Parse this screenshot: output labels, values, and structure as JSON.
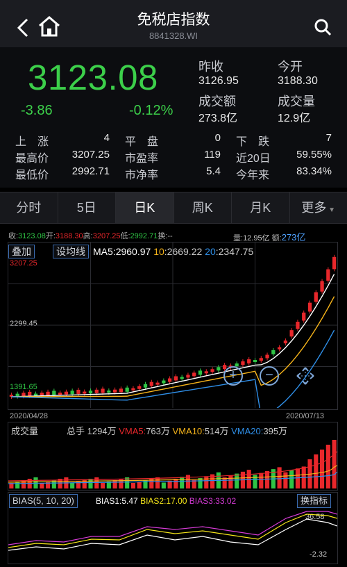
{
  "header": {
    "title": "免税店指数",
    "code": "8841328.WI"
  },
  "quote": {
    "price": "3123.08",
    "change": "-3.86",
    "change_pct": "-0.12%",
    "prev_close_label": "昨收",
    "prev_close": "3126.95",
    "open_label": "今开",
    "open": "3188.30",
    "turnover_label": "成交额",
    "turnover": "273.8亿",
    "volume_label": "成交量",
    "volume": "12.9亿"
  },
  "stats": {
    "rows": [
      [
        {
          "label": "上　涨",
          "value": "4"
        },
        {
          "label": "平　盘",
          "value": "0"
        },
        {
          "label": "下　跌",
          "value": "7"
        }
      ],
      [
        {
          "label": "最高价",
          "value": "3207.25"
        },
        {
          "label": "市盈率",
          "value": "119"
        },
        {
          "label": "近20日",
          "value": "59.55%"
        }
      ],
      [
        {
          "label": "最低价",
          "value": "2992.71"
        },
        {
          "label": "市净率",
          "value": "5.4"
        },
        {
          "label": "今年来",
          "value": "83.34%"
        }
      ]
    ]
  },
  "tabs": [
    "分时",
    "5日",
    "日K",
    "周K",
    "月K",
    "更多"
  ],
  "active_tab": "日K",
  "infoline": {
    "close_label": "收:",
    "close": "3123.08",
    "open_label": "开:",
    "open": "3188.30",
    "high_label": "高:",
    "high": "3207.25",
    "low_label": "低:",
    "low": "2992.71",
    "hand_label": "换:",
    "hand": "--",
    "vol_label": "量:",
    "vol": "12.95亿",
    "amt_label": "额:",
    "amt": "273亿"
  },
  "kline": {
    "add_btn": "叠加",
    "ma_btn": "设均线",
    "ma_line": {
      "ma_prefix": "MA",
      "ma5_label": "5",
      "ma5": "2960.97",
      "ma10_label": "10",
      "ma10": "2669.22",
      "ma20_label": "20",
      "ma20": "2347.75"
    },
    "y_high": "3207.25",
    "y_mid": "2299.45",
    "y_low": "1391.65",
    "date_start": "2020/04/28",
    "date_end": "2020/07/13"
  },
  "volume_panel": {
    "title": "成交量",
    "total_label": "总手",
    "total": "1294万",
    "vma5_label": "VMA5:",
    "vma5": "763万",
    "vma10_label": "VMA10:",
    "vma10": "514万",
    "vma20_label": "VMA20:",
    "vma20": "395万"
  },
  "bias_panel": {
    "title": "BIAS(5, 10, 20)",
    "bias1_label": "BIAS1:",
    "bias1": "5.47",
    "bias2_label": "BIAS2:",
    "bias2": "17.00",
    "bias3_label": "BIAS3:",
    "bias3": "33.02",
    "switch_btn": "换指标",
    "y_top": "36.58",
    "y_bottom": "-2.32"
  },
  "colors": {
    "up": "#e8272b",
    "down": "#2fc445",
    "ma5": "#ffffff",
    "ma10": "#f5b31a",
    "ma20": "#2f8fe8",
    "bias3": "#d63bd6"
  }
}
